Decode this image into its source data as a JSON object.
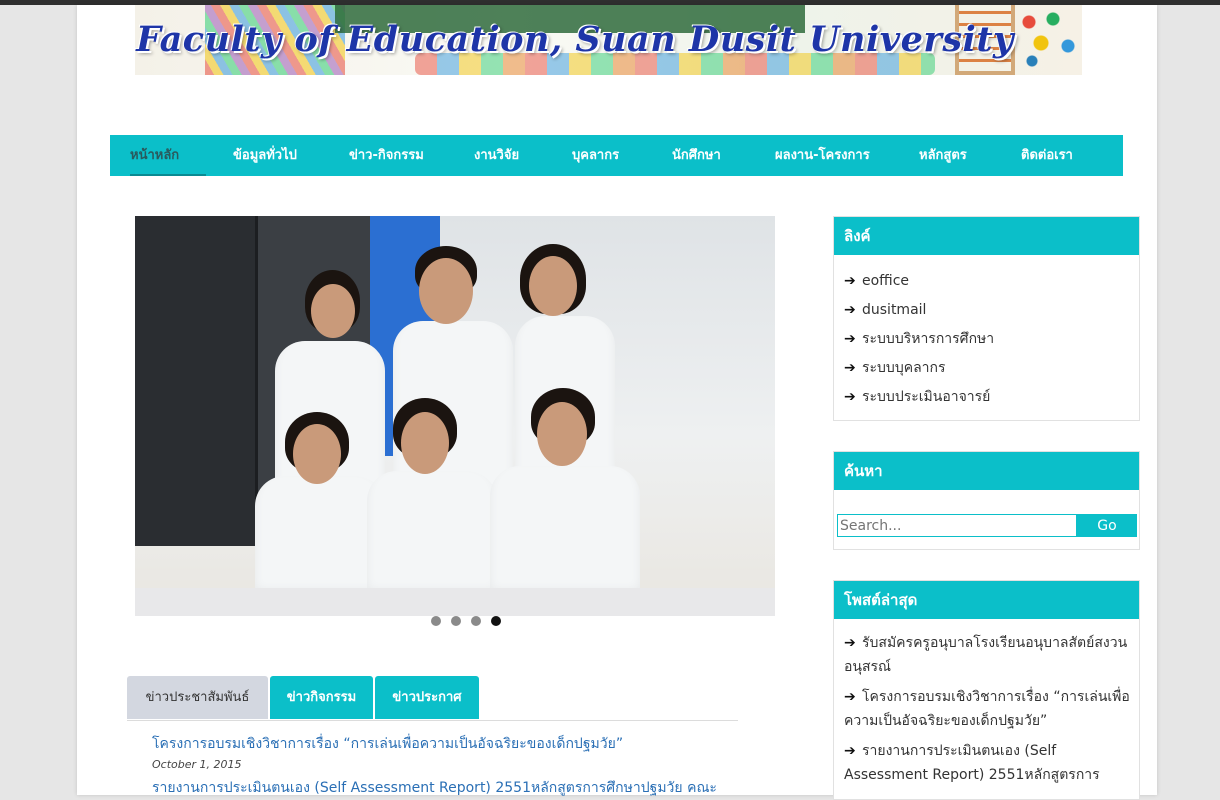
{
  "header": {
    "title": "Faculty of Education, Suan Dusit University"
  },
  "nav": {
    "items": [
      {
        "label": "หน้าหลัก",
        "active": true
      },
      {
        "label": "ข้อมูลทั่วไป"
      },
      {
        "label": "ข่าว-กิจกรรม"
      },
      {
        "label": "งานวิจัย"
      },
      {
        "label": "บุคลากร"
      },
      {
        "label": "นักศึกษา"
      },
      {
        "label": "ผลงาน-โครงการ"
      },
      {
        "label": "หลักสูตร"
      },
      {
        "label": "ติดต่อเรา"
      }
    ]
  },
  "slider": {
    "slide_count": 4,
    "active_index": 3
  },
  "tabs": [
    {
      "label": "ข่าวประชาสัมพันธ์",
      "active": true
    },
    {
      "label": "ข่าวกิจกรรม"
    },
    {
      "label": "ข่าวประกาศ"
    }
  ],
  "news": [
    {
      "title": "โครงการอบรมเชิงวิชาการเรื่อง “การเล่นเพื่อความเป็นอัจฉริยะของเด็กปฐมวัย”",
      "date": "October 1, 2015"
    },
    {
      "title": "รายงานการประเมินตนเอง (Self Assessment Report) 2551หลักสูตรการศึกษาปฐมวัย คณะ"
    }
  ],
  "sidebar": {
    "links": {
      "heading": "ลิงค์",
      "items": [
        "eoffice",
        "dusitmail",
        "ระบบบริหารการศึกษา",
        "ระบบบุคลากร",
        "ระบบประเมินอาจารย์"
      ]
    },
    "search": {
      "heading": "ค้นหา",
      "placeholder": "Search...",
      "button": "Go"
    },
    "recent": {
      "heading": "โพสต์ล่าสุด",
      "items": [
        "รับสมัครครูอนุบาลโรงเรียนอนุบาลสัตย์สงวน อนุสรณ์",
        "โครงการอบรมเชิงวิชาการเรื่อง “การเล่นเพื่อความเป็นอัจฉริยะของเด็กปฐมวัย”",
        "รายงานการประเมินตนเอง (Self Assessment Report) 2551หลักสูตรการ"
      ]
    }
  },
  "colors": {
    "accent": "#0bbfc9",
    "link": "#2a6fb5",
    "title": "#1e35a8"
  }
}
